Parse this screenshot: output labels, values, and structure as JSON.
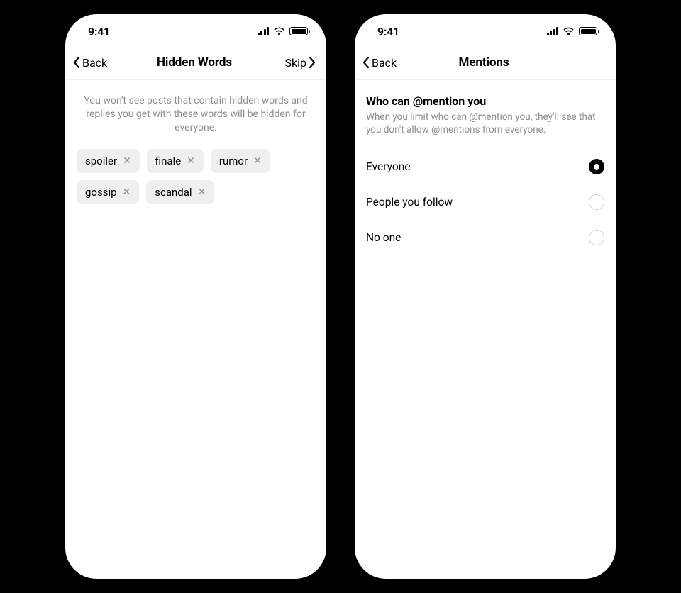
{
  "status": {
    "time": "9:41"
  },
  "left_screen": {
    "nav": {
      "back": "Back",
      "title": "Hidden Words",
      "skip": "Skip"
    },
    "description": "You won't see posts that contain hidden words and replies you get with these words will be hidden for everyone.",
    "chips": [
      {
        "label": "spoiler"
      },
      {
        "label": "finale"
      },
      {
        "label": "rumor"
      },
      {
        "label": "gossip"
      },
      {
        "label": "scandal"
      }
    ]
  },
  "right_screen": {
    "nav": {
      "back": "Back",
      "title": "Mentions"
    },
    "section": {
      "title": "Who can @mention you",
      "subtitle": "When you limit who can @mention you, they'll see that you don't allow @mentions from everyone."
    },
    "options": [
      {
        "label": "Everyone",
        "selected": true
      },
      {
        "label": "People you follow",
        "selected": false
      },
      {
        "label": "No one",
        "selected": false
      }
    ]
  }
}
